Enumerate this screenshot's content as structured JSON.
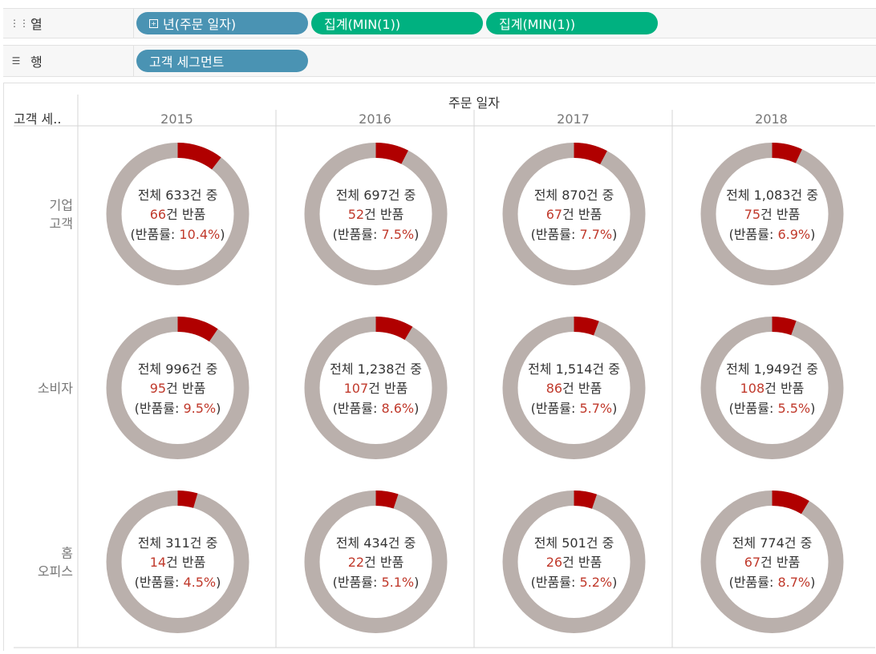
{
  "shelves": {
    "columns": {
      "label": "열",
      "icon": "columns-icon",
      "pills": [
        {
          "text": "년(주문 일자)",
          "color": "#4a93b3"
        },
        {
          "text": "집계(MIN(1))",
          "color": "#00b180"
        },
        {
          "text": "집계(MIN(1))",
          "color": "#00b180"
        }
      ]
    },
    "rows": {
      "label": "행",
      "icon": "rows-icon",
      "pills": [
        {
          "text": "고객 세그먼트",
          "color": "#4a93b3"
        }
      ]
    }
  },
  "chart_data": {
    "type": "donut-grid",
    "column_header": "주문 일자",
    "row_header": "고객 세..",
    "columns": [
      "2015",
      "2016",
      "2017",
      "2018"
    ],
    "rows": [
      {
        "label_lines": [
          "기업",
          "고객"
        ]
      },
      {
        "label_lines": [
          "소비자"
        ]
      },
      {
        "label_lines": [
          "홈",
          "오피스"
        ]
      }
    ],
    "colors": {
      "returned": "#b00000",
      "rest": "#bab0ac",
      "accent_text": "#c0392b"
    },
    "cells": [
      [
        {
          "total": "633",
          "returns": "66",
          "rate": "10.4%",
          "fraction": 0.104
        },
        {
          "total": "697",
          "returns": "52",
          "rate": "7.5%",
          "fraction": 0.075
        },
        {
          "total": "870",
          "returns": "67",
          "rate": "7.7%",
          "fraction": 0.077
        },
        {
          "total": "1,083",
          "returns": "75",
          "rate": "6.9%",
          "fraction": 0.069
        }
      ],
      [
        {
          "total": "996",
          "returns": "95",
          "rate": "9.5%",
          "fraction": 0.095
        },
        {
          "total": "1,238",
          "returns": "107",
          "rate": "8.6%",
          "fraction": 0.086
        },
        {
          "total": "1,514",
          "returns": "86",
          "rate": "5.7%",
          "fraction": 0.057
        },
        {
          "total": "1,949",
          "returns": "108",
          "rate": "5.5%",
          "fraction": 0.055
        }
      ],
      [
        {
          "total": "311",
          "returns": "14",
          "rate": "4.5%",
          "fraction": 0.045
        },
        {
          "total": "434",
          "returns": "22",
          "rate": "5.1%",
          "fraction": 0.051
        },
        {
          "total": "501",
          "returns": "26",
          "rate": "5.2%",
          "fraction": 0.052
        },
        {
          "total": "774",
          "returns": "67",
          "rate": "8.7%",
          "fraction": 0.087
        }
      ]
    ],
    "label_template": {
      "line1_prefix": "전체 ",
      "line1_suffix": "건 중",
      "line2_suffix": "건 반품",
      "line3_prefix": "(반품률: ",
      "line3_suffix": ")"
    }
  }
}
